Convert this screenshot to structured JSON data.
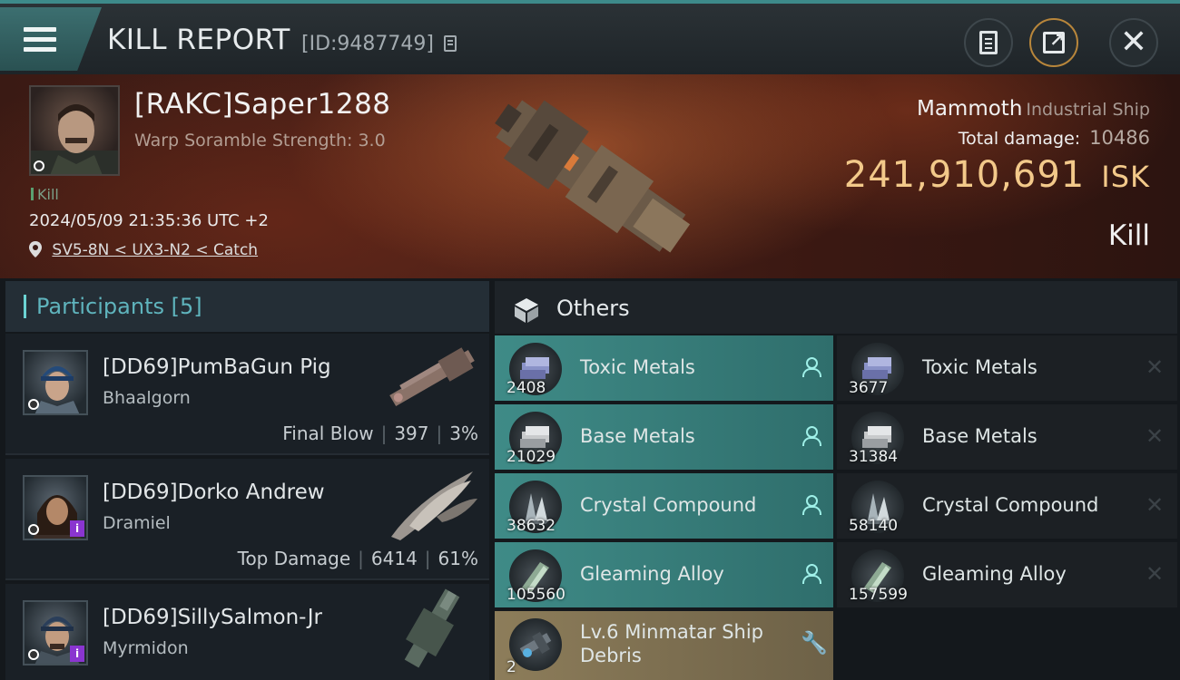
{
  "header": {
    "title": "KILL REPORT",
    "report_id": "[ID:9487749]"
  },
  "victim": {
    "name": "[RAKC]Saper1288",
    "subtitle": "Warp Soramble Strength: 3.0",
    "tag": "Kill",
    "datetime": "2024/05/09 21:35:36 UTC +2",
    "location": "SV5-8N < UX3-N2 < Catch",
    "ship_name": "Mammoth",
    "ship_class": "Industrial Ship",
    "total_damage_label": "Total damage:",
    "total_damage": "10486",
    "isk_value": "241,910,691",
    "isk_unit": "ISK",
    "kill_type": "Kill"
  },
  "participants": {
    "header": "Participants [5]",
    "rows": [
      {
        "name": "[DD69]PumBaGun Pig",
        "ship": "Bhaalgorn",
        "role": "Final Blow",
        "damage": "397",
        "percent": "3%"
      },
      {
        "name": "[DD69]Dorko Andrew",
        "ship": "Dramiel",
        "role": "Top Damage",
        "damage": "6414",
        "percent": "61%"
      },
      {
        "name": "[DD69]SillySalmon-Jr",
        "ship": "Myrmidon"
      }
    ]
  },
  "others": {
    "title": "Others",
    "dropped": [
      {
        "qty": "2408",
        "name": "Toxic Metals"
      },
      {
        "qty": "21029",
        "name": "Base Metals"
      },
      {
        "qty": "38632",
        "name": "Crystal Compound"
      },
      {
        "qty": "105560",
        "name": "Gleaming Alloy"
      }
    ],
    "destroyed": [
      {
        "qty": "3677",
        "name": "Toxic Metals"
      },
      {
        "qty": "31384",
        "name": "Base Metals"
      },
      {
        "qty": "58140",
        "name": "Crystal Compound"
      },
      {
        "qty": "157599",
        "name": "Gleaming Alloy"
      }
    ],
    "special": {
      "qty": "2",
      "name_line1": "Lv.6 Minmatar Ship",
      "name_line2": "Debris"
    }
  },
  "colors": {
    "accent": "#3d8a8a",
    "isk": "#f3c98a",
    "dropped": "#3f8b87",
    "special": "#8d7d5a"
  },
  "icons": [
    "menu-icon",
    "copy-icon",
    "clipboard-icon",
    "share-icon",
    "close-icon",
    "location-pin-icon",
    "cube-icon",
    "person-icon",
    "x-icon",
    "wrench-icon"
  ]
}
